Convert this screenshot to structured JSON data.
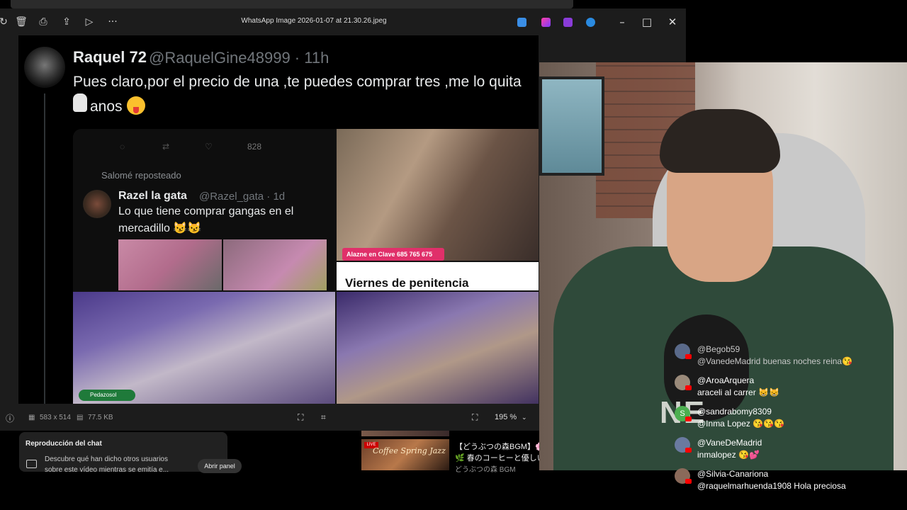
{
  "viewer": {
    "file_title": "WhatsApp Image 2026-01-07 at 21.30.26.jpeg",
    "menu_glyph": "···",
    "dimensions": "583 x 514",
    "file_size": "77.5 KB",
    "zoom": "195 %"
  },
  "tweet": {
    "name": "Raquel 72",
    "handle": "@RaquelGine48999 · 11h",
    "text_line1": "Pues claro,por el precio de una ,te puedes comprar tres ,me lo quita",
    "text_line2": "anos",
    "more": "···"
  },
  "embedded": {
    "stat_views": "828",
    "repost_label": "Salomé reposteado",
    "name": "Razel la gata",
    "handle": "@Razel_gata · 1d",
    "text_line1": "Lo que tiene comprar gangas en el",
    "text_line2": "mercadillo 😼😼",
    "badge": "Alazne en Clave 685 765 675",
    "caption": "Viernes de penitencia",
    "tag": "Pedazosol"
  },
  "below": {
    "chat_title": "Reproducción del chat",
    "chat_desc1": "Descubre qué han dicho otros usuarios",
    "chat_desc2": "sobre este vídeo mientras se emitía e...",
    "open_panel": "Abrir panel",
    "thumb_live": "LIVE",
    "thumb_text": "Coffee Spring Jazz",
    "video_title1": "【どうぶつの森BGM】🌸",
    "video_title2": "🌿 春のコーヒーと優しい",
    "video_channel": "どうぶつの森 BGM"
  },
  "webcam": {
    "shirt_text": "NE"
  },
  "chat": [
    {
      "user": "@Begob59",
      "text": "@VanedeMadrid buenas noches reina😘",
      "avatar_color": "#5a6a8a",
      "faded": true
    },
    {
      "user": "@AroaArquera",
      "text": "araceli al carrer 😸😸",
      "avatar_color": "#9a8a7a",
      "faded": false
    },
    {
      "user": "@sandrabomy8309",
      "text": "@Inma Lopez 😘😘😘",
      "avatar_color": "#4caf50",
      "faded": false
    },
    {
      "user": "@VaneDeMadrid",
      "text": "inmalopez 😘💕",
      "avatar_color": "#6a7aa0",
      "faded": false
    },
    {
      "user": "@Silvia-Canariona",
      "text": "@raquelmarhuenda1908 Hola preciosa",
      "avatar_color": "#8a6a5a",
      "faded": false
    }
  ],
  "colors": {
    "viewer_bg": "#1c1c1c",
    "youtube_red": "#ff0000",
    "badge_pink": "#e0306a"
  }
}
